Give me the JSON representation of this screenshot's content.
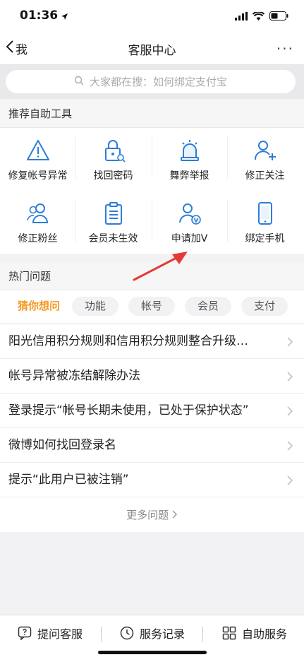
{
  "status": {
    "time": "01:36"
  },
  "nav": {
    "back_label": "我",
    "title": "客服中心",
    "more": "···"
  },
  "search": {
    "placeholder": "大家都在搜：如何绑定支付宝"
  },
  "tools_section": {
    "title": "推荐自助工具",
    "items": [
      {
        "label": "修复帐号异常",
        "icon": "warning-icon"
      },
      {
        "label": "找回密码",
        "icon": "lock-icon"
      },
      {
        "label": "舞弊举报",
        "icon": "alarm-icon"
      },
      {
        "label": "修正关注",
        "icon": "add-user-icon"
      },
      {
        "label": "修正粉丝",
        "icon": "users-icon"
      },
      {
        "label": "会员未生效",
        "icon": "clipboard-icon"
      },
      {
        "label": "申请加V",
        "icon": "verified-user-icon"
      },
      {
        "label": "绑定手机",
        "icon": "phone-icon"
      }
    ]
  },
  "faq_section": {
    "title": "热门问题",
    "tabs": [
      "猜你想问",
      "功能",
      "帐号",
      "会员",
      "支付"
    ],
    "active_tab": "猜你想问",
    "questions": [
      "阳光信用积分规则和信用积分规则整合升级…",
      "帐号异常被冻结解除办法",
      "登录提示“帐号长期未使用，已处于保护状态”",
      "微博如何找回登录名",
      "提示“此用户已被注销”"
    ],
    "more_label": "更多问题"
  },
  "bottom_bar": {
    "items": [
      {
        "label": "提问客服",
        "icon": "question-icon"
      },
      {
        "label": "服务记录",
        "icon": "clock-icon"
      },
      {
        "label": "自助服务",
        "icon": "grid-icon"
      }
    ]
  },
  "colors": {
    "accent": "#f59a23",
    "icon_blue": "#2d7ed6",
    "annotation_red": "#e53935"
  }
}
